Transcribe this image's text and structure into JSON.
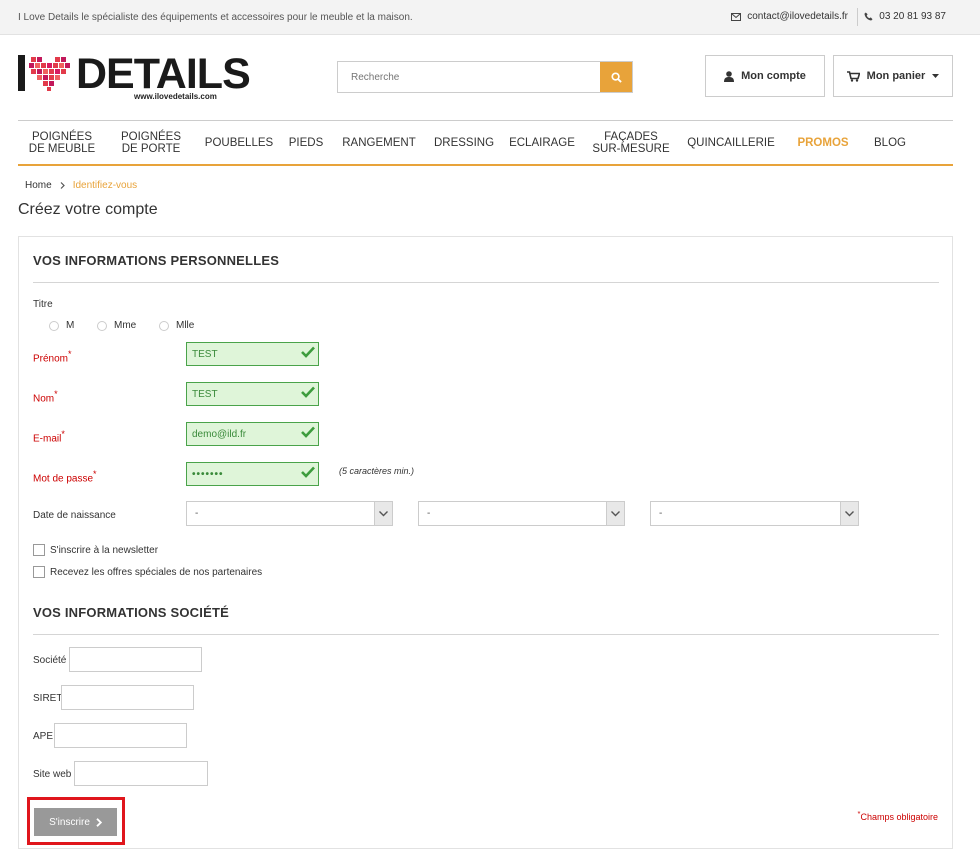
{
  "topbar": {
    "tagline": "I Love Details le spécialiste des équipements et accessoires pour le meuble et la maison.",
    "email": "contact@ilovedetails.fr",
    "phone": "03 20 81 93 87"
  },
  "logo": {
    "word": "DETAILS",
    "url": "www.ilovedetails.com"
  },
  "search": {
    "placeholder": "Recherche"
  },
  "header": {
    "account_label": "Mon compte",
    "cart_label": "Mon panier"
  },
  "nav": [
    "POIGNÉES\nDE MEUBLE",
    "POIGNÉES\nDE PORTE",
    "POUBELLES",
    "PIEDS",
    "RANGEMENT",
    "DRESSING",
    "ECLAIRAGE",
    "FAÇADES\nSUR-MESURE",
    "QUINCAILLERIE",
    "PROMOS",
    "BLOG"
  ],
  "breadcrumb": {
    "home": "Home",
    "current": "Identifiez-vous"
  },
  "page_title": "Créez votre compte",
  "personal": {
    "heading": "VOS INFORMATIONS PERSONNELLES",
    "title_label": "Titre",
    "titles": [
      "M",
      "Mme",
      "Mlle"
    ],
    "firstname_label": "Prénom",
    "firstname_value": "TEST",
    "lastname_label": "Nom",
    "lastname_value": "TEST",
    "email_label": "E-mail",
    "email_value": "demo@ild.fr",
    "password_label": "Mot de passe",
    "password_value": "•••••••",
    "password_hint": "(5 caractères min.)",
    "birthdate_label": "Date de naissance",
    "birthdate_values": [
      "-",
      "-",
      "-"
    ],
    "newsletter_label": "S'inscrire à la newsletter",
    "partners_label": "Recevez les offres spéciales de nos partenaires",
    "required_mark": "*"
  },
  "company": {
    "heading": "VOS INFORMATIONS SOCIÉTÉ",
    "company_label": "Société",
    "siret_label": "SIRET",
    "ape_label": "APE",
    "website_label": "Site web"
  },
  "submit_label": "S'inscrire",
  "required_note": "Champs obligatoire",
  "colors": {
    "accent": "#e8a33a",
    "valid": "#4aa34a",
    "error": "#c00000",
    "highlight": "#e0161c"
  }
}
